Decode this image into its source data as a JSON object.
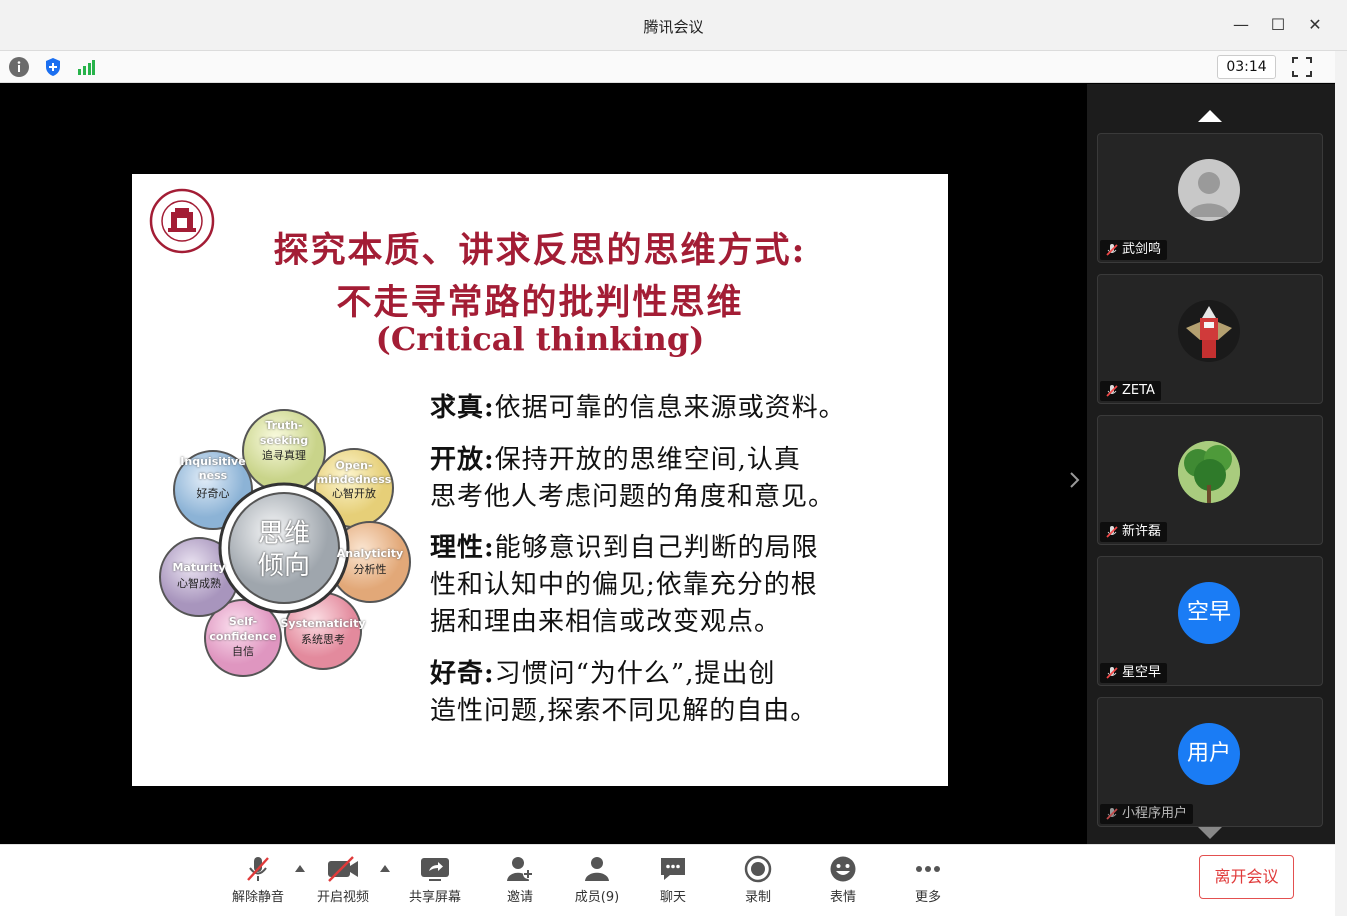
{
  "window": {
    "title": "腾讯会议",
    "minimize": "—",
    "maximize": "☐",
    "close": "✕"
  },
  "toolbar": {
    "timer": "03:14"
  },
  "slide": {
    "title_line1": "探究本质、讲求反思的思维方式:",
    "title_line2": "不走寻常路的批判性思维",
    "title_line3": "(Critical thinking)",
    "center_label_1": "思维",
    "center_label_2": "倾向",
    "petals": [
      {
        "en": "Truth-",
        "en2": "seeking",
        "zh": "追寻真理"
      },
      {
        "en": "Open-",
        "en2": "mindedness",
        "zh": "心智开放"
      },
      {
        "en": "Analyticity",
        "en2": "",
        "zh": "分析性"
      },
      {
        "en": "Systematicity",
        "en2": "",
        "zh": "系统思考"
      },
      {
        "en": "Self-",
        "en2": "confidence",
        "zh": "自信"
      },
      {
        "en": "Maturity",
        "en2": "",
        "zh": "心智成熟"
      },
      {
        "en": "Inquisitive",
        "en2": "ness",
        "zh": "好奇心"
      }
    ],
    "p1_head": "求真:",
    "p1_text": "依据可靠的信息来源或资料。",
    "p2_head": "开放:",
    "p2_text": "保持开放的思维空间,认真",
    "p2_line2": "思考他人考虑问题的角度和意见。",
    "p3_head": "理性:",
    "p3_text": "能够意识到自己判断的局限",
    "p3_line2": "性和认知中的偏见;依靠充分的根",
    "p3_line3": "据和理由来相信或改变观点。",
    "p4_head": "好奇:",
    "p4_text": "习惯问“为什么”,提出创",
    "p4_line2": "造性问题,探索不同见解的自由。"
  },
  "participants": [
    {
      "name": "武剑鸣",
      "avatar_type": "default"
    },
    {
      "name": "ZETA",
      "avatar_type": "image"
    },
    {
      "name": "新许磊",
      "avatar_type": "tree"
    },
    {
      "name": "星空早",
      "avatar_text": "空早",
      "color": "#1a7cf5"
    },
    {
      "name": "小程序用户",
      "avatar_text": "用户",
      "color": "#1a7cf5"
    }
  ],
  "bottom": {
    "unmute": "解除静音",
    "video": "开启视频",
    "share": "共享屏幕",
    "invite": "邀请",
    "members": "成员(9)",
    "chat": "聊天",
    "record": "录制",
    "emoji": "表情",
    "more": "更多",
    "leave": "离开会议"
  },
  "colors": {
    "accent_red": "#a31d35",
    "blue_avatar": "#1a7cf5",
    "leave_red": "#e03a3a"
  }
}
